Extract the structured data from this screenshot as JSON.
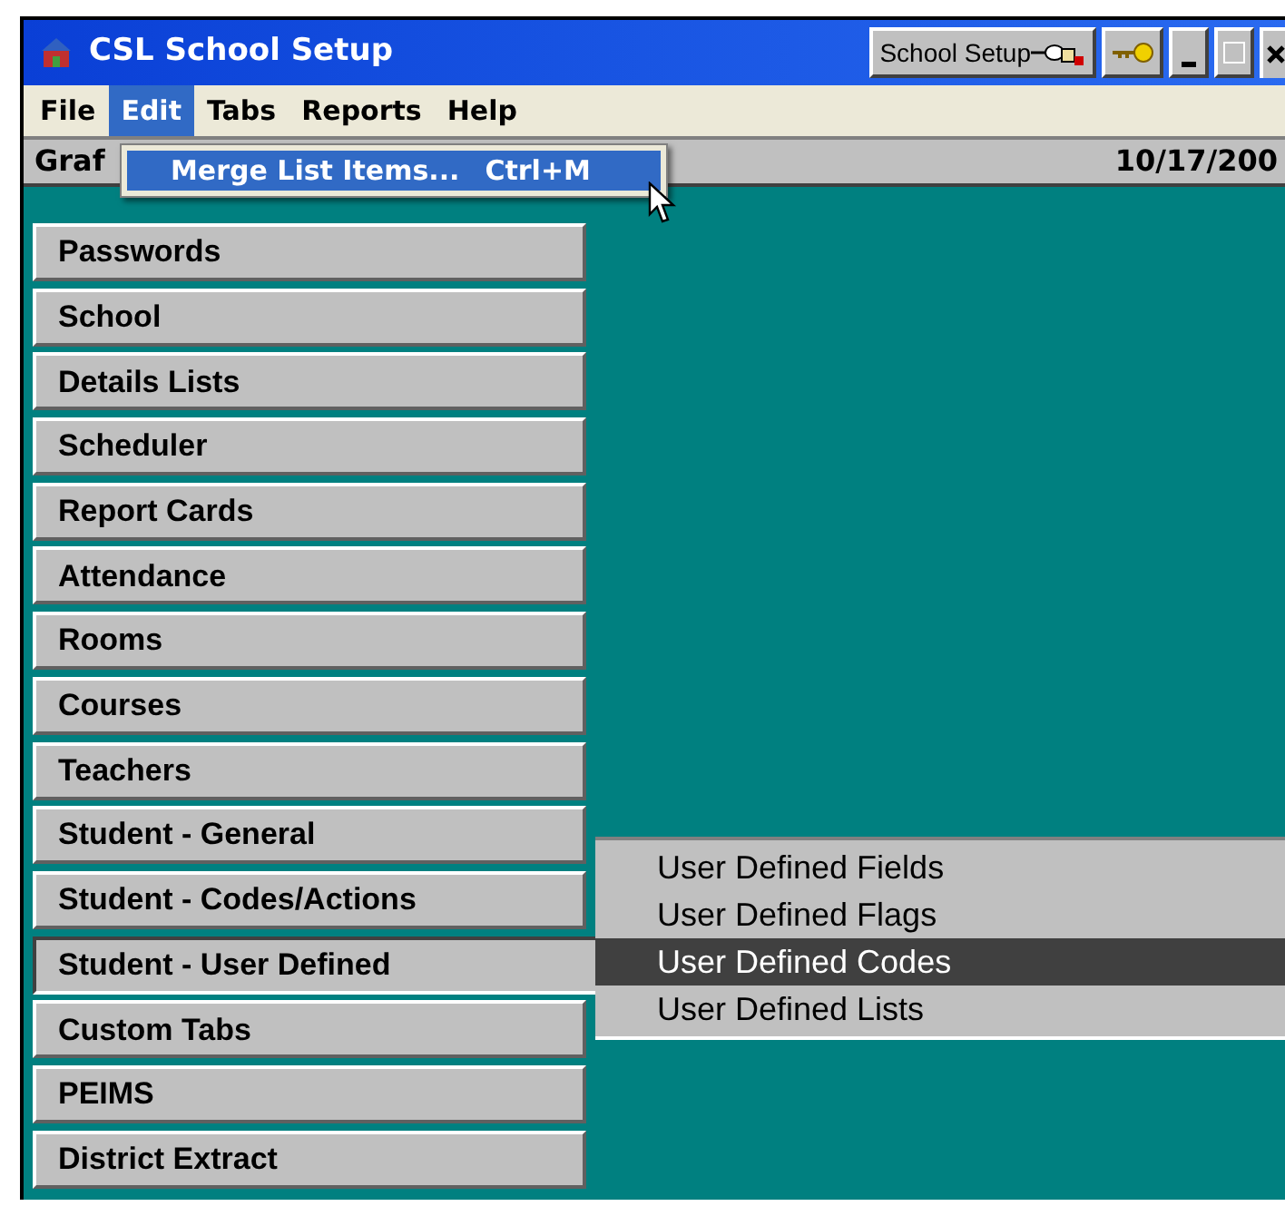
{
  "window": {
    "title": "CSL School Setup"
  },
  "title_controls": {
    "school_setup_button": "School Setup"
  },
  "menu_bar": [
    {
      "label": "File",
      "selected": false
    },
    {
      "label": "Edit",
      "selected": true
    },
    {
      "label": "Tabs",
      "selected": false
    },
    {
      "label": "Reports",
      "selected": false
    },
    {
      "label": "Help",
      "selected": false
    }
  ],
  "edit_menu": [
    {
      "label": "Merge List Items...",
      "shortcut": "Ctrl+M",
      "selected": true
    }
  ],
  "status_bar": {
    "left": "Graf",
    "date": "10/17/200"
  },
  "tab_buttons": [
    {
      "label": "Passwords",
      "selected": false
    },
    {
      "label": "School",
      "selected": false
    },
    {
      "label": "Details Lists",
      "selected": false
    },
    {
      "label": "Scheduler",
      "selected": false
    },
    {
      "label": "Report Cards",
      "selected": false
    },
    {
      "label": "Attendance",
      "selected": false
    },
    {
      "label": "Rooms",
      "selected": false
    },
    {
      "label": "Courses",
      "selected": false
    },
    {
      "label": "Teachers",
      "selected": false
    },
    {
      "label": "Student - General",
      "selected": false
    },
    {
      "label": "Student - Codes/Actions",
      "selected": false
    },
    {
      "label": "Student - User Defined",
      "selected": true
    },
    {
      "label": "Custom Tabs",
      "selected": false
    },
    {
      "label": "PEIMS",
      "selected": false
    },
    {
      "label": "District Extract",
      "selected": false
    }
  ],
  "submenu": [
    {
      "label": "User Defined Fields",
      "selected": false
    },
    {
      "label": "User Defined Flags",
      "selected": false
    },
    {
      "label": "User Defined Codes",
      "selected": true
    },
    {
      "label": "User Defined Lists",
      "selected": false
    }
  ]
}
